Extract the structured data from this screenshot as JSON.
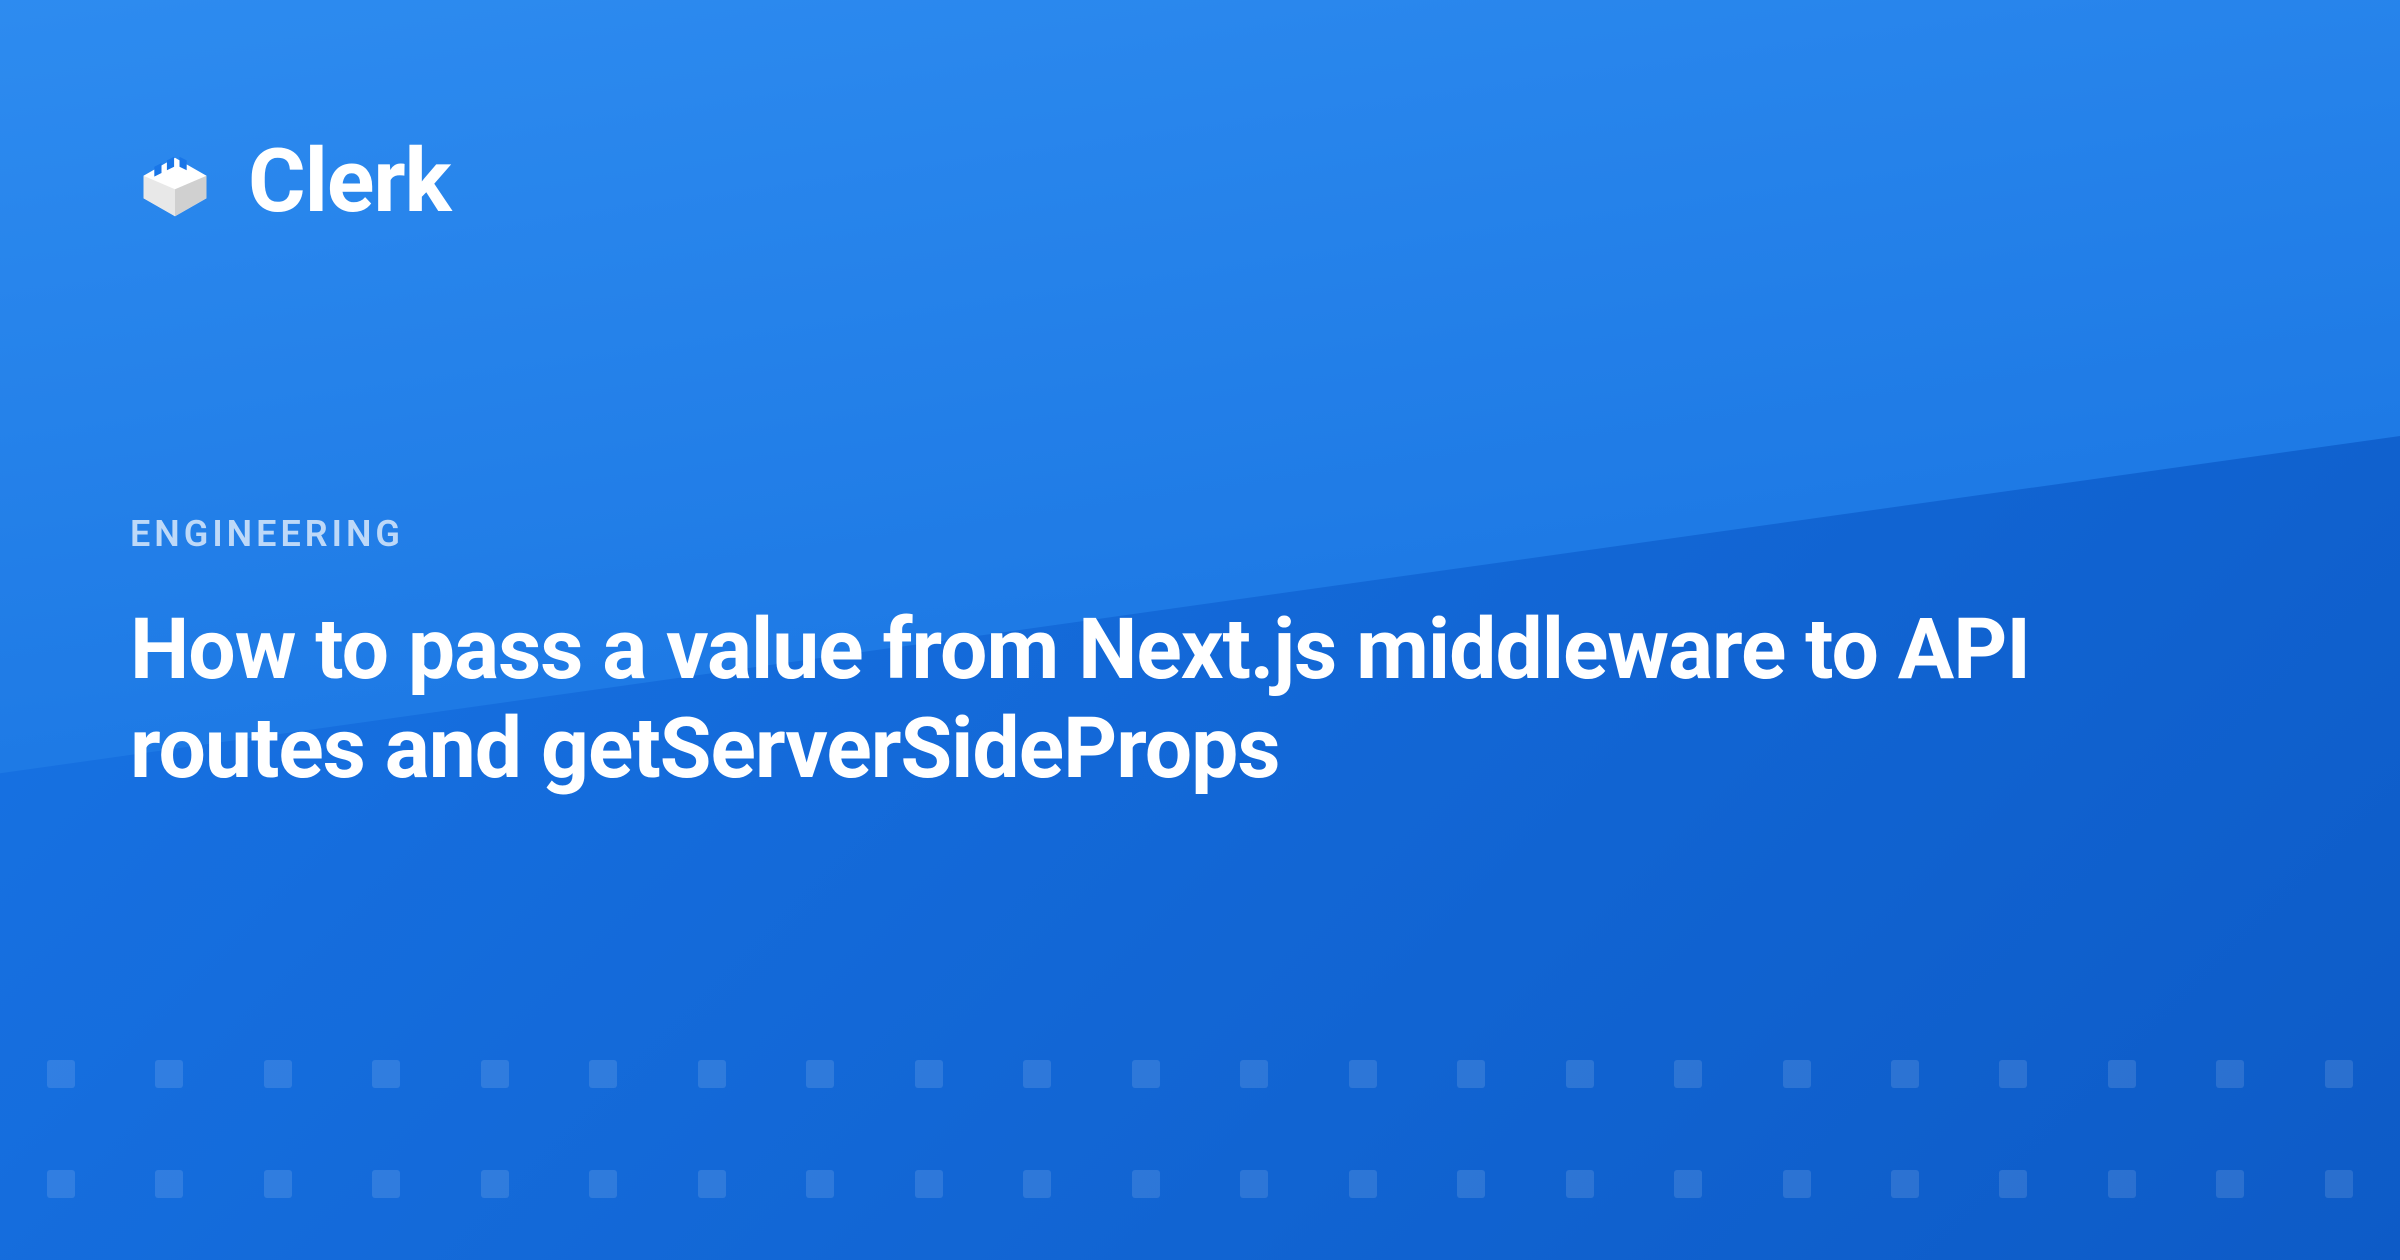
{
  "logo": {
    "brand_name": "Clerk"
  },
  "category": "ENGINEERING",
  "title": "How to pass a value from Next.js middleware to API routes and getServerSideProps",
  "colors": {
    "primary_blue": "#1976e8",
    "dark_blue": "#0d5bc7",
    "light_blue": "#2e8cf0"
  }
}
